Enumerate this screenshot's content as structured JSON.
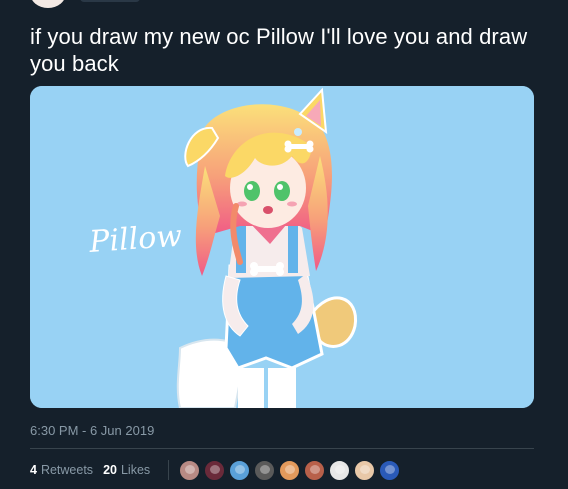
{
  "tweet": {
    "text": "if you draw my new oc Pillow I'll love you and draw you back",
    "image_caption": "Pillow",
    "timestamp": "6:30 PM - 6 Jun 2019"
  },
  "stats": {
    "retweets_count": "4",
    "retweets_label": "Retweets",
    "likes_count": "20",
    "likes_label": "Likes"
  },
  "likers": [
    {
      "color": "#b88a84",
      "icon": "avatar"
    },
    {
      "color": "#6a2a3a",
      "icon": "avatar"
    },
    {
      "color": "#5aa0d8",
      "icon": "avatar"
    },
    {
      "color": "#5a5a5a",
      "icon": "avatar"
    },
    {
      "color": "#e39a5c",
      "icon": "avatar"
    },
    {
      "color": "#b8604a",
      "icon": "avatar"
    },
    {
      "color": "#e8e8e8",
      "icon": "avatar"
    },
    {
      "color": "#e8c8a8",
      "icon": "avatar"
    },
    {
      "color": "#2a5ab8",
      "icon": "avatar"
    }
  ],
  "colors": {
    "background": "#15202b",
    "secondary_text": "#8899a6",
    "divider": "#38444d",
    "image_background": "#98d2f4"
  }
}
